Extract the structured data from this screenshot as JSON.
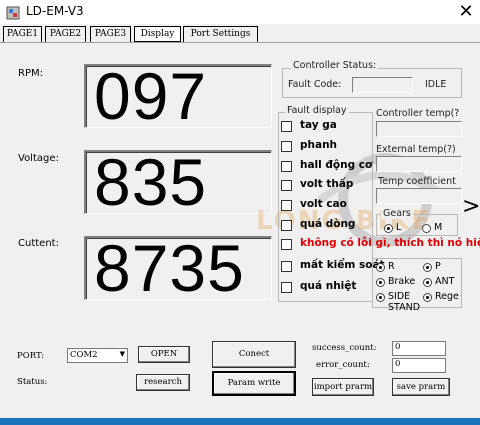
{
  "window": {
    "title": "LD-EM-V3",
    "close_glyph": "✕"
  },
  "tabs": [
    {
      "label": "PAGE1",
      "active": false
    },
    {
      "label": "PAGE2",
      "active": false
    },
    {
      "label": "PAGE3",
      "active": false
    },
    {
      "label": "Display",
      "active": true
    },
    {
      "label": "Port Settings",
      "active": false
    }
  ],
  "gauges": {
    "rpm": {
      "label": "RPM:",
      "value": "097"
    },
    "voltage": {
      "label": "Voltage:",
      "value": "835"
    },
    "current": {
      "label": "Cuttent:",
      "value": "8735"
    }
  },
  "controller_status": {
    "title": "Controller Status:",
    "fault_code_label": "Fault Code:",
    "fault_code_value": "",
    "state": "IDLE"
  },
  "fault_display": {
    "title": "Fault display",
    "items": [
      {
        "label": "tay ga",
        "checked": false,
        "highlight": false
      },
      {
        "label": "phanh",
        "checked": false,
        "highlight": false
      },
      {
        "label": "hall động cơ",
        "checked": false,
        "highlight": false
      },
      {
        "label": "volt thấp",
        "checked": false,
        "highlight": false
      },
      {
        "label": "volt cao",
        "checked": false,
        "highlight": false
      },
      {
        "label": "quá dòng",
        "checked": false,
        "highlight": false
      },
      {
        "label": "không có lỗi gì, thích thì nó hiện",
        "checked": false,
        "highlight": true
      },
      {
        "label": "mất kiểm soát",
        "checked": false,
        "highlight": false
      },
      {
        "label": "quá nhiệt",
        "checked": false,
        "highlight": false
      }
    ]
  },
  "side_fields": {
    "controller_temp": {
      "label": "Controller temp(?",
      "value": ""
    },
    "external_temp": {
      "label": "External temp(?)",
      "value": ""
    },
    "temp_coefficient": {
      "label": "Temp coefficient",
      "value": ""
    }
  },
  "gears": {
    "title": "Gears",
    "options": [
      {
        "label": "L",
        "selected": true
      },
      {
        "label": "M",
        "selected": false
      }
    ]
  },
  "mode_radios": [
    {
      "label": "R",
      "selected": true
    },
    {
      "label": "P",
      "selected": true
    },
    {
      "label": "Brake",
      "selected": true
    },
    {
      "label": "ANT",
      "selected": true
    },
    {
      "label": "SIDE STAND",
      "selected": true
    },
    {
      "label": "Rege",
      "selected": true
    }
  ],
  "watermark": {
    "text": "LONG BIKE"
  },
  "chevron_glyph": ">",
  "bottom": {
    "port_label": "PORT:",
    "port_value": "COM2",
    "open_label": "OPEN",
    "status_label": "Status:",
    "research_label": "research",
    "connect_label": "Conect",
    "param_write_label": "Param write",
    "success_count_label": "success_count:",
    "success_count_value": "0",
    "error_count_label": "error_count:",
    "error_count_value": "0",
    "import_label": "import prarm",
    "save_label": "save prarm"
  },
  "colors": {
    "accent_bar": "#1e73be",
    "highlight_text": "#e00000",
    "watermark": "#e6a04a"
  }
}
